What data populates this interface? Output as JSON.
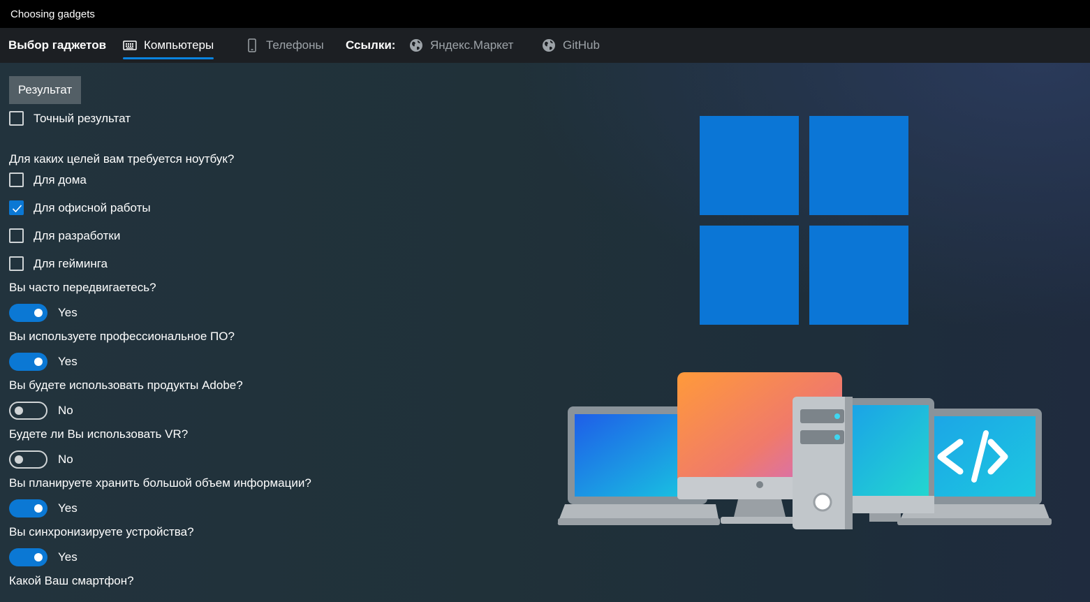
{
  "window": {
    "title": "Choosing gadgets"
  },
  "nav": {
    "app_title": "Выбор гаджетов",
    "tabs": [
      {
        "label": "Компьютеры",
        "icon": "keyboard-icon",
        "active": true
      },
      {
        "label": "Телефоны",
        "icon": "phone-icon",
        "active": false
      }
    ],
    "links_label": "Ссылки:",
    "links": [
      {
        "label": "Яндекс.Маркет",
        "icon": "globe-icon"
      },
      {
        "label": "GitHub",
        "icon": "globe-icon"
      }
    ]
  },
  "form": {
    "result_button": "Результат",
    "exact_result": {
      "label": "Точный результат",
      "checked": false
    },
    "purpose_question": "Для каких целей вам требуется ноутбук?",
    "purposes": [
      {
        "label": "Для дома",
        "checked": false
      },
      {
        "label": "Для офисной работы",
        "checked": true
      },
      {
        "label": "Для разработки",
        "checked": false
      },
      {
        "label": "Для гейминга",
        "checked": false
      }
    ],
    "toggles": [
      {
        "question": "Вы часто передвигаетесь?",
        "on": true,
        "state_label": "Yes"
      },
      {
        "question": "Вы используете профессиональное ПО?",
        "on": true,
        "state_label": "Yes"
      },
      {
        "question": "Вы будете использовать продукты Adobe?",
        "on": false,
        "state_label": "No"
      },
      {
        "question": "Будете ли Вы использовать VR?",
        "on": false,
        "state_label": "No"
      },
      {
        "question": "Вы планируете хранить большой объем информации?",
        "on": true,
        "state_label": "Yes"
      },
      {
        "question": "Вы синхронизируете устройства?",
        "on": true,
        "state_label": "Yes"
      }
    ],
    "smartphone_question": "Какой Ваш смартфон?"
  },
  "colors": {
    "accent": "#0b78d4",
    "windows_logo": "#0b76d6",
    "titlebar": "#000000",
    "navbar": "#1c1f23",
    "button": "#535f66"
  }
}
